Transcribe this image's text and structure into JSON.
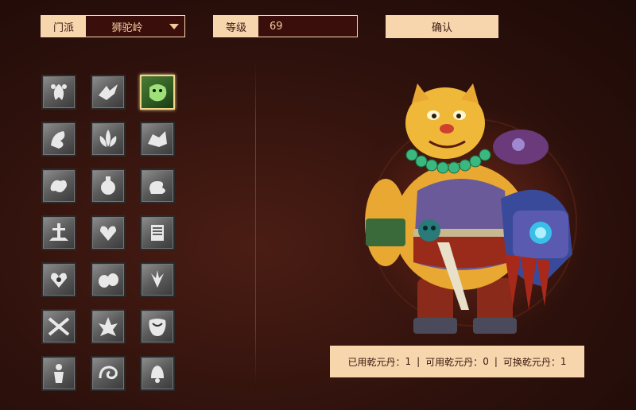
{
  "filters": {
    "school": {
      "label": "门派",
      "value": "狮驼岭"
    },
    "level": {
      "label": "等级",
      "value": "69"
    },
    "confirm_label": "确认"
  },
  "skills": [
    {
      "name": "paw-skill-icon",
      "selected": false
    },
    {
      "name": "eagle-skill-icon",
      "selected": false
    },
    {
      "name": "leopard-skill-icon",
      "selected": true
    },
    {
      "name": "lion-claw-skill-icon",
      "selected": false
    },
    {
      "name": "lotus-skill-icon",
      "selected": false
    },
    {
      "name": "beast-skill-icon",
      "selected": false
    },
    {
      "name": "dragon-skill-icon",
      "selected": false
    },
    {
      "name": "orb-skill-icon",
      "selected": false
    },
    {
      "name": "cloud-skill-icon",
      "selected": false
    },
    {
      "name": "sword-skill-icon",
      "selected": false
    },
    {
      "name": "heart-skill-icon",
      "selected": false
    },
    {
      "name": "scroll-skill-icon",
      "selected": false
    },
    {
      "name": "spiral-heart-skill-icon",
      "selected": false
    },
    {
      "name": "stones-skill-icon",
      "selected": false
    },
    {
      "name": "wings-skill-icon",
      "selected": false
    },
    {
      "name": "crossed-blades-skill-icon",
      "selected": false
    },
    {
      "name": "spikes-skill-icon",
      "selected": false
    },
    {
      "name": "pattern-skill-icon",
      "selected": false
    },
    {
      "name": "warrior-skill-icon",
      "selected": false
    },
    {
      "name": "snail-skill-icon",
      "selected": false
    },
    {
      "name": "bell-skill-icon",
      "selected": false
    }
  ],
  "stats": {
    "used_label": "已用乾元丹：",
    "used_value": "1",
    "available_label": "可用乾元丹：",
    "available_value": "0",
    "exchangeable_label": "可换乾元丹：",
    "exchangeable_value": "1",
    "separator": "|"
  },
  "colors": {
    "accent": "#f7d6ae",
    "field_bg": "#3a0f0b",
    "value_text": "#f5c89a",
    "selected_border": "#f3d58a"
  }
}
